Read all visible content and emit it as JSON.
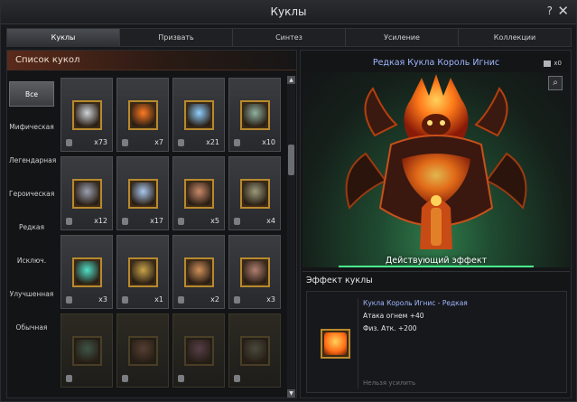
{
  "window": {
    "title": "Куклы",
    "help_icon": "?",
    "close_icon": "✕"
  },
  "tabs": [
    {
      "label": "Куклы",
      "active": true
    },
    {
      "label": "Призвать",
      "active": false
    },
    {
      "label": "Синтез",
      "active": false
    },
    {
      "label": "Усиление",
      "active": false
    },
    {
      "label": "Коллекции",
      "active": false
    }
  ],
  "list": {
    "header": "Список кукол",
    "filters": [
      "Все",
      "Мифическая",
      "Легендарная",
      "Героическая",
      "Редкая",
      "Исключ.",
      "Улучшенная",
      "Обычная"
    ],
    "active_filter": "Все",
    "scroll_up": "▲",
    "scroll_down": "▼",
    "cards": [
      {
        "count": "x73",
        "color": "#cfd4da",
        "dim": false
      },
      {
        "count": "x7",
        "color": "#ff7a22",
        "dim": false
      },
      {
        "count": "x21",
        "color": "#8fd0ff",
        "dim": false
      },
      {
        "count": "x10",
        "color": "#8fb2a0",
        "dim": false
      },
      {
        "count": "x12",
        "color": "#9aa0b0",
        "dim": false
      },
      {
        "count": "x17",
        "color": "#a9c8ee",
        "dim": false
      },
      {
        "count": "x5",
        "color": "#c98a6a",
        "dim": false
      },
      {
        "count": "x4",
        "color": "#9a9a7a",
        "dim": false
      },
      {
        "count": "x3",
        "color": "#4fe0c8",
        "dim": false
      },
      {
        "count": "x1",
        "color": "#c9a34a",
        "dim": false
      },
      {
        "count": "x2",
        "color": "#d0905a",
        "dim": false
      },
      {
        "count": "x3",
        "color": "#b08070",
        "dim": false
      },
      {
        "count": "",
        "color": "#4a6a5a",
        "dim": true
      },
      {
        "count": "",
        "color": "#6a4a3a",
        "dim": true
      },
      {
        "count": "",
        "color": "#6a4a5a",
        "dim": true
      },
      {
        "count": "",
        "color": "#5a5a4a",
        "dim": true
      }
    ]
  },
  "detail": {
    "name": "Редкая Кукла Король Игнис",
    "owned": "x0",
    "magnify_icon": "⌕",
    "active_effect_label": "Действующий эффект",
    "effect_section_title": "Эффект куклы",
    "effect_title": "Кукла Король Игнис - Редкая",
    "effect_lines": [
      "Атака огнем +40",
      "Физ. Атк. +200"
    ],
    "footer": "Нельзя усилить",
    "accent": "#9fb8ff",
    "bar_color": "#49ff8f"
  }
}
